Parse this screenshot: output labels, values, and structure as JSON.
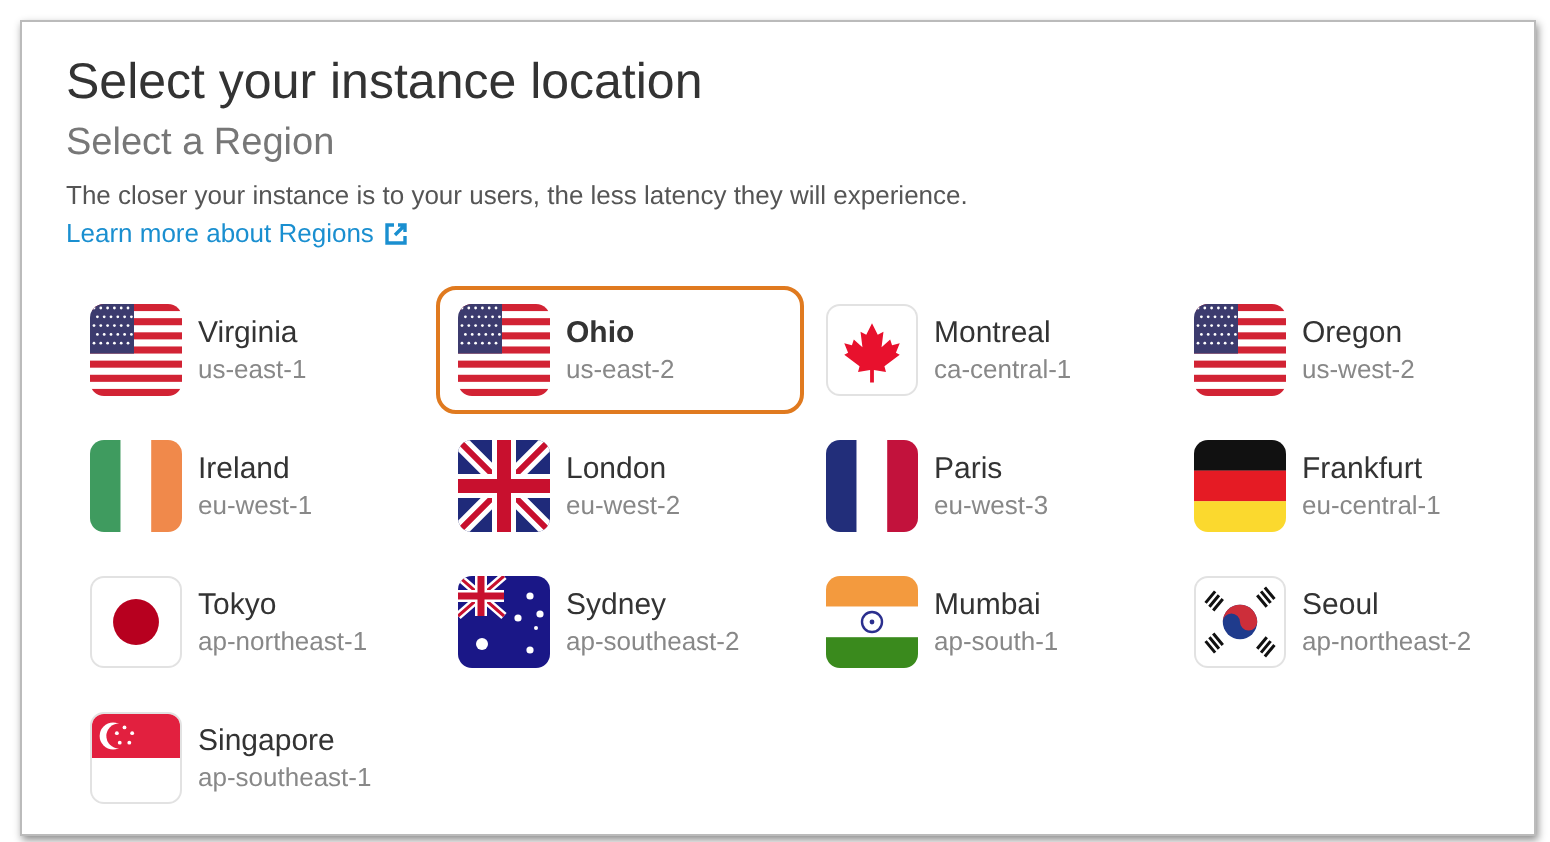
{
  "title": "Select your instance location",
  "subtitle": "Select a Region",
  "description": "The closer your instance is to your users, the less latency they will experience.",
  "link": "Learn more about Regions",
  "regions": [
    {
      "name": "Virginia",
      "code": "us-east-1",
      "kind": "us",
      "selected": false
    },
    {
      "name": "Ohio",
      "code": "us-east-2",
      "kind": "us",
      "selected": true
    },
    {
      "name": "Montreal",
      "code": "ca-central-1",
      "kind": "ca",
      "selected": false
    },
    {
      "name": "Oregon",
      "code": "us-west-2",
      "kind": "us",
      "selected": false
    },
    {
      "name": "Ireland",
      "code": "eu-west-1",
      "kind": "ie",
      "selected": false
    },
    {
      "name": "London",
      "code": "eu-west-2",
      "kind": "gb",
      "selected": false
    },
    {
      "name": "Paris",
      "code": "eu-west-3",
      "kind": "fr",
      "selected": false
    },
    {
      "name": "Frankfurt",
      "code": "eu-central-1",
      "kind": "de",
      "selected": false
    },
    {
      "name": "Tokyo",
      "code": "ap-northeast-1",
      "kind": "jp",
      "selected": false
    },
    {
      "name": "Sydney",
      "code": "ap-southeast-2",
      "kind": "au",
      "selected": false
    },
    {
      "name": "Mumbai",
      "code": "ap-south-1",
      "kind": "in",
      "selected": false
    },
    {
      "name": "Seoul",
      "code": "ap-northeast-2",
      "kind": "kr",
      "selected": false
    },
    {
      "name": "Singapore",
      "code": "ap-southeast-1",
      "kind": "sg",
      "selected": false
    }
  ]
}
